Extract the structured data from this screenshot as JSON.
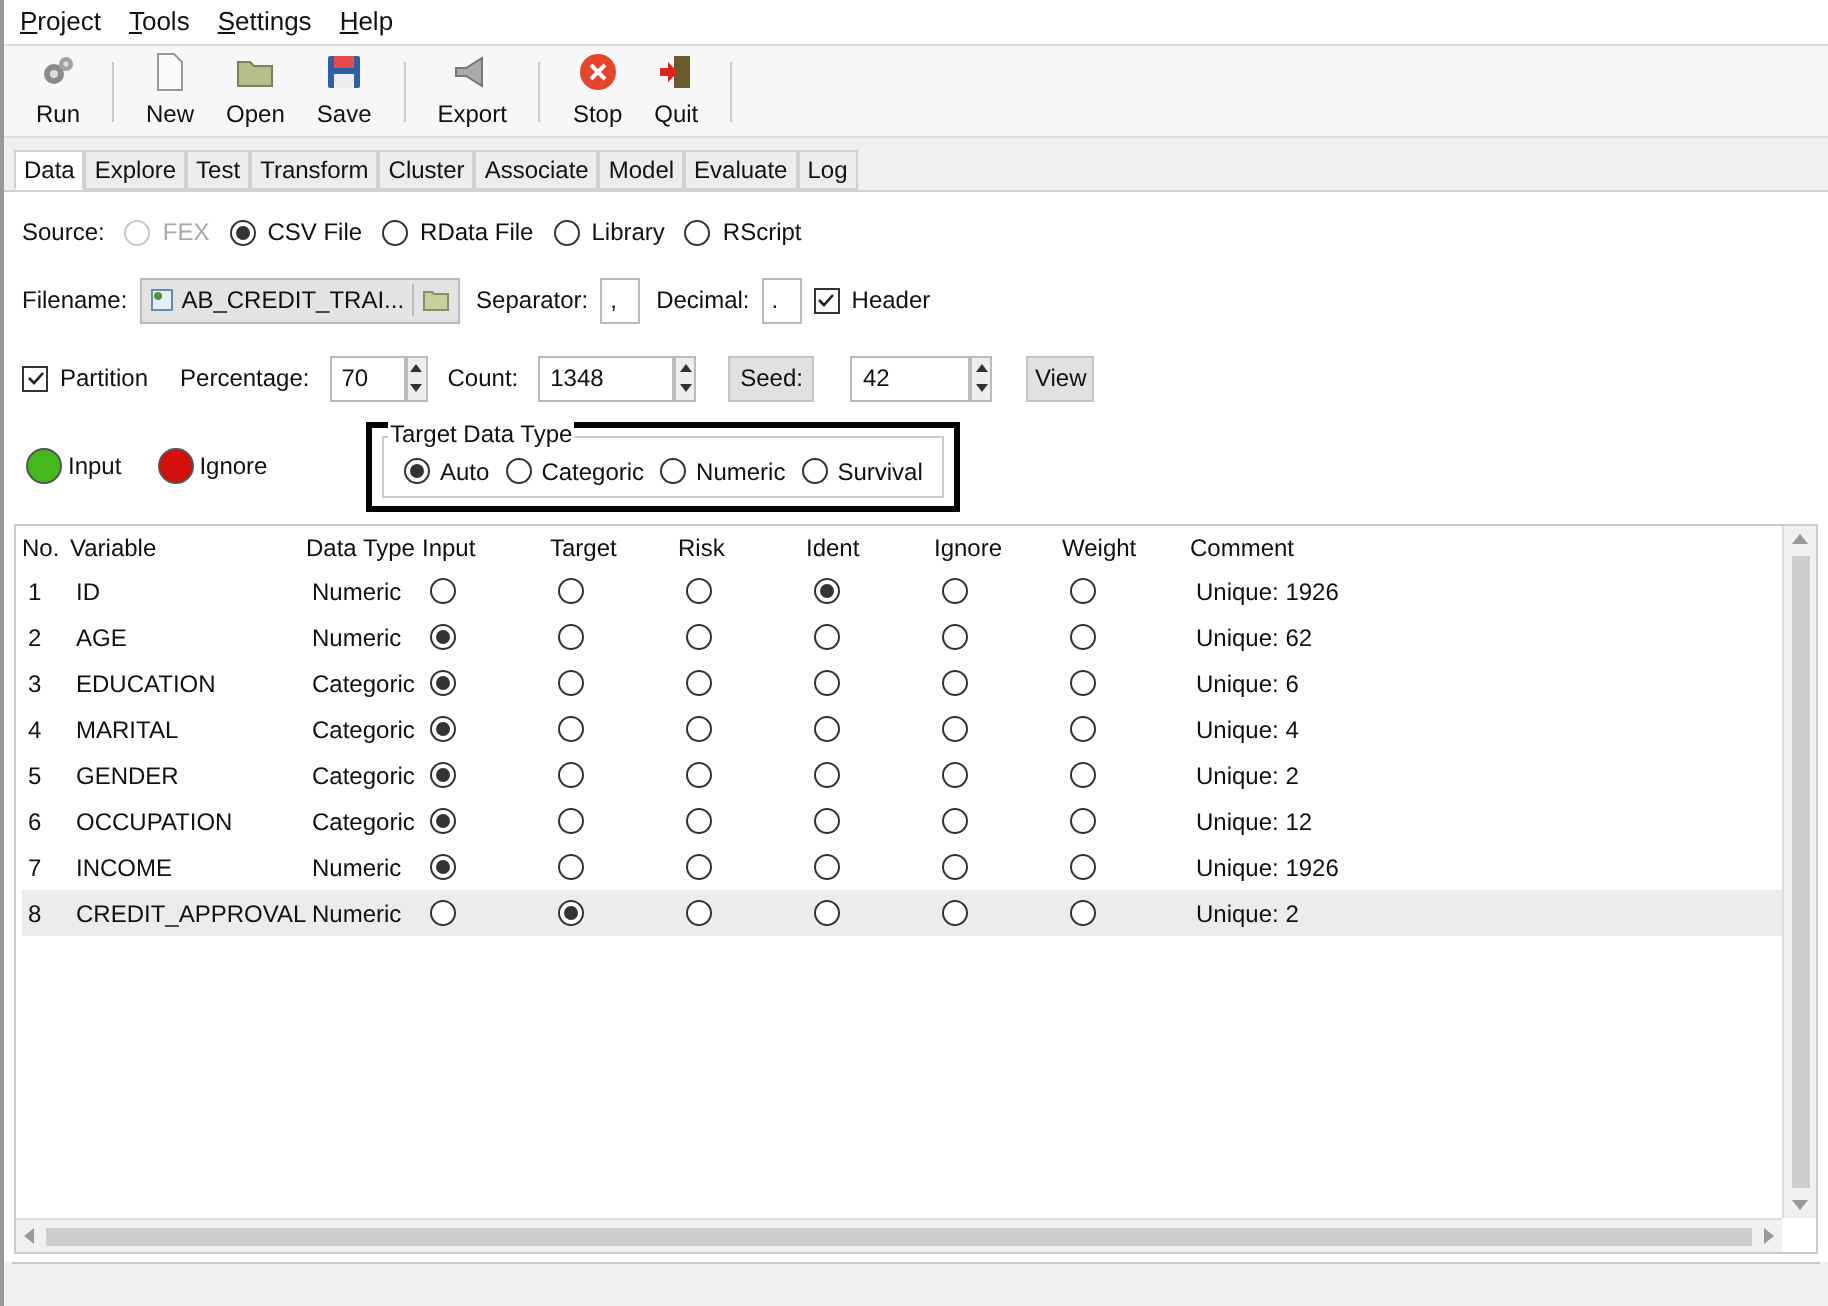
{
  "menu": [
    "Project",
    "Tools",
    "Settings",
    "Help"
  ],
  "toolbar": [
    {
      "label": "Run",
      "kind": "gears"
    },
    {
      "label": "New",
      "kind": "page"
    },
    {
      "label": "Open",
      "kind": "folder"
    },
    {
      "label": "Save",
      "kind": "disk"
    },
    {
      "label": "Export",
      "kind": "export"
    },
    {
      "label": "Stop",
      "kind": "stop"
    },
    {
      "label": "Quit",
      "kind": "quit"
    }
  ],
  "tabs": [
    {
      "label": "Data",
      "selected": true
    },
    {
      "label": "Explore",
      "selected": false
    },
    {
      "label": "Test",
      "selected": false
    },
    {
      "label": "Transform",
      "selected": false
    },
    {
      "label": "Cluster",
      "selected": false
    },
    {
      "label": "Associate",
      "selected": false
    },
    {
      "label": "Model",
      "selected": false
    },
    {
      "label": "Evaluate",
      "selected": false
    },
    {
      "label": "Log",
      "selected": false
    }
  ],
  "source": {
    "label": "Source:",
    "options": [
      {
        "label": "FEX",
        "selected": false,
        "disabled": true
      },
      {
        "label": "CSV File",
        "selected": true,
        "disabled": false
      },
      {
        "label": "RData File",
        "selected": false,
        "disabled": false
      },
      {
        "label": "Library",
        "selected": false,
        "disabled": false
      },
      {
        "label": "RScript",
        "selected": false,
        "disabled": false
      }
    ]
  },
  "file": {
    "label": "Filename:",
    "value": "AB_CREDIT_TRAI...",
    "separator_label": "Separator:",
    "separator": ",",
    "decimal_label": "Decimal:",
    "decimal": ".",
    "header": {
      "label": "Header",
      "checked": true
    }
  },
  "partition": {
    "label": "Partition",
    "checked": true,
    "percentage_label": "Percentage:",
    "percentage": "70",
    "count_label": "Count:",
    "count": "1348",
    "seed_button": "Seed:",
    "seed": "42",
    "view_button": "View"
  },
  "legend": [
    {
      "label": "Input",
      "color": "#44b91c"
    },
    {
      "label": "Ignore",
      "color": "#d40d0d"
    }
  ],
  "target_type": {
    "title": "Target Data Type",
    "options": [
      {
        "label": "Auto",
        "selected": true
      },
      {
        "label": "Categoric",
        "selected": false
      },
      {
        "label": "Numeric",
        "selected": false
      },
      {
        "label": "Survival",
        "selected": false
      }
    ]
  },
  "table": {
    "columns": [
      "No.",
      "Variable",
      "Data Type",
      "Input",
      "Target",
      "Risk",
      "Ident",
      "Ignore",
      "Weight",
      "Comment"
    ],
    "rows": [
      {
        "no": "1",
        "variable": "ID",
        "data_type": "Numeric",
        "selected": false,
        "roles": [
          {
            "selected": false
          },
          {
            "selected": false
          },
          {
            "selected": false
          },
          {
            "selected": true
          },
          {
            "selected": false
          },
          {
            "selected": false
          }
        ],
        "comment": "Unique: 1926"
      },
      {
        "no": "2",
        "variable": "AGE",
        "data_type": "Numeric",
        "selected": false,
        "roles": [
          {
            "selected": true
          },
          {
            "selected": false
          },
          {
            "selected": false
          },
          {
            "selected": false
          },
          {
            "selected": false
          },
          {
            "selected": false
          }
        ],
        "comment": "Unique: 62"
      },
      {
        "no": "3",
        "variable": "EDUCATION",
        "data_type": "Categoric",
        "selected": false,
        "roles": [
          {
            "selected": true
          },
          {
            "selected": false
          },
          {
            "selected": false
          },
          {
            "selected": false
          },
          {
            "selected": false
          },
          {
            "selected": false
          }
        ],
        "comment": "Unique: 6"
      },
      {
        "no": "4",
        "variable": "MARITAL",
        "data_type": "Categoric",
        "selected": false,
        "roles": [
          {
            "selected": true
          },
          {
            "selected": false
          },
          {
            "selected": false
          },
          {
            "selected": false
          },
          {
            "selected": false
          },
          {
            "selected": false
          }
        ],
        "comment": "Unique: 4"
      },
      {
        "no": "5",
        "variable": "GENDER",
        "data_type": "Categoric",
        "selected": false,
        "roles": [
          {
            "selected": true
          },
          {
            "selected": false
          },
          {
            "selected": false
          },
          {
            "selected": false
          },
          {
            "selected": false
          },
          {
            "selected": false
          }
        ],
        "comment": "Unique: 2"
      },
      {
        "no": "6",
        "variable": "OCCUPATION",
        "data_type": "Categoric",
        "selected": false,
        "roles": [
          {
            "selected": true
          },
          {
            "selected": false
          },
          {
            "selected": false
          },
          {
            "selected": false
          },
          {
            "selected": false
          },
          {
            "selected": false
          }
        ],
        "comment": "Unique: 12"
      },
      {
        "no": "7",
        "variable": "INCOME",
        "data_type": "Numeric",
        "selected": false,
        "roles": [
          {
            "selected": true
          },
          {
            "selected": false
          },
          {
            "selected": false
          },
          {
            "selected": false
          },
          {
            "selected": false
          },
          {
            "selected": false
          }
        ],
        "comment": "Unique: 1926"
      },
      {
        "no": "8",
        "variable": "CREDIT_APPROVAL",
        "data_type": "Numeric",
        "selected": true,
        "roles": [
          {
            "selected": false
          },
          {
            "selected": true
          },
          {
            "selected": false
          },
          {
            "selected": false
          },
          {
            "selected": false
          },
          {
            "selected": false
          }
        ],
        "comment": "Unique: 2"
      }
    ]
  }
}
